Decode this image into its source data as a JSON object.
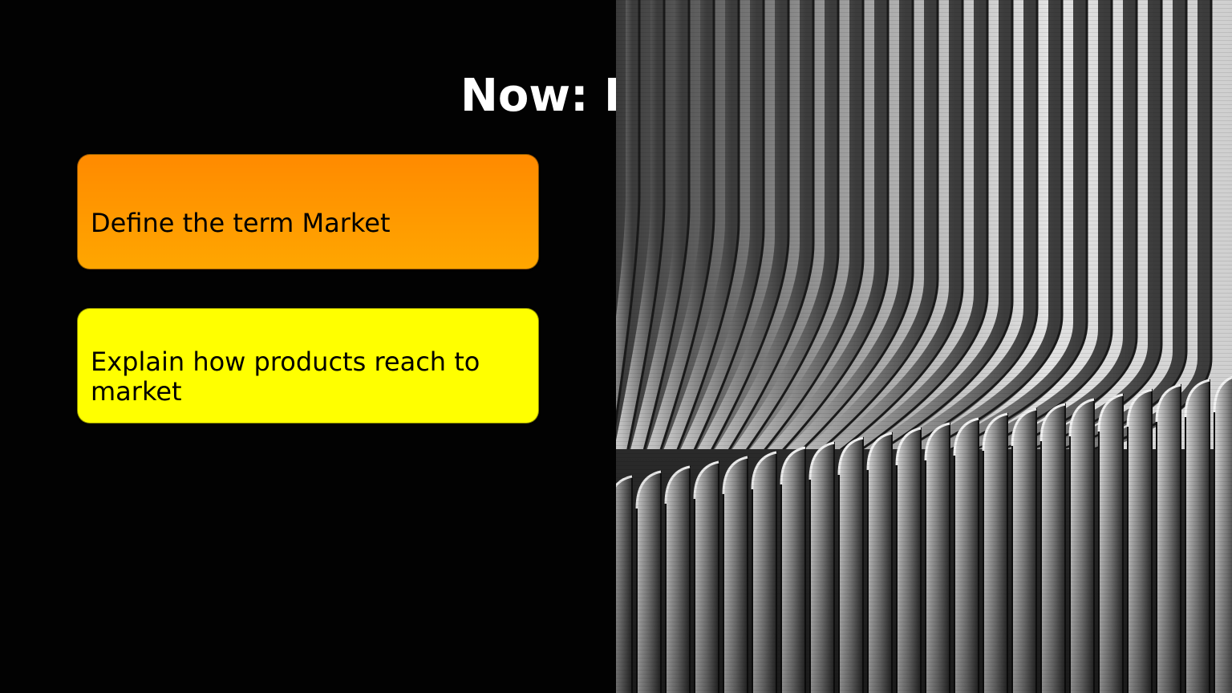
{
  "slide": {
    "title": "Now: L",
    "objectives": [
      {
        "text": "Define the term Market",
        "color": "#ff9500"
      },
      {
        "text": "Explain how products reach to market",
        "color": "#ffff00"
      }
    ]
  },
  "image": {
    "subject": "black-and-white curved architecture facade photo"
  },
  "colors": {
    "background": "#020202",
    "title": "#ffffff",
    "card_orange": "#ff9500",
    "card_yellow": "#ffff00"
  }
}
